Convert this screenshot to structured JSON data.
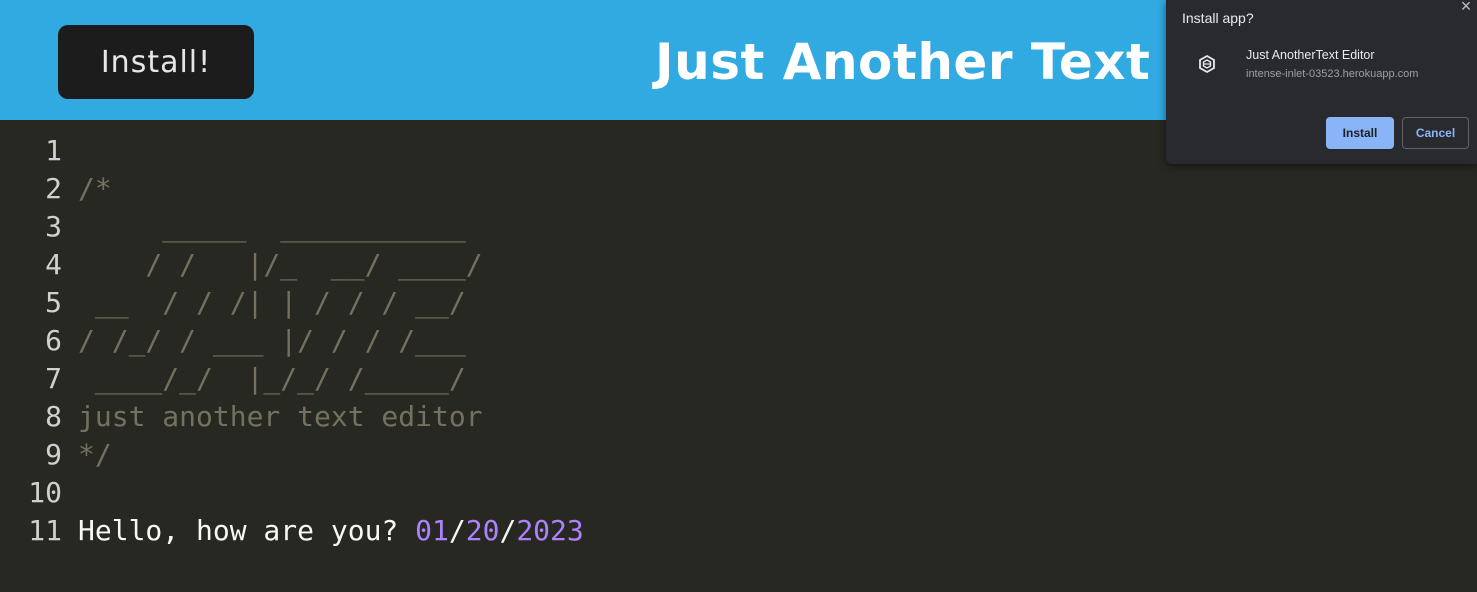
{
  "header": {
    "install_label": "Install!",
    "title": "Just Another Text"
  },
  "editor": {
    "lines": [
      {
        "number": "1",
        "segments": []
      },
      {
        "number": "2",
        "segments": [
          {
            "text": "/*",
            "kind": "comment"
          }
        ]
      },
      {
        "number": "3",
        "segments": [
          {
            "text": "     _____  ___________",
            "kind": "comment"
          }
        ]
      },
      {
        "number": "4",
        "segments": [
          {
            "text": "    / /   |/_  __/ ____/",
            "kind": "comment"
          }
        ]
      },
      {
        "number": "5",
        "segments": [
          {
            "text": " __  / / /| | / / / __/",
            "kind": "comment"
          }
        ]
      },
      {
        "number": "6",
        "segments": [
          {
            "text": "/ /_/ / ___ |/ / / /___",
            "kind": "comment"
          }
        ]
      },
      {
        "number": "7",
        "segments": [
          {
            "text": " ____/_/  |_/_/ /_____/",
            "kind": "comment"
          }
        ]
      },
      {
        "number": "8",
        "segments": [
          {
            "text": "just another text editor",
            "kind": "comment"
          }
        ]
      },
      {
        "number": "9",
        "segments": [
          {
            "text": "*/",
            "kind": "comment"
          }
        ]
      },
      {
        "number": "10",
        "segments": []
      },
      {
        "number": "11",
        "segments": [
          {
            "text": "Hello, how are you? ",
            "kind": "plain"
          },
          {
            "text": "01",
            "kind": "num"
          },
          {
            "text": "/",
            "kind": "plain"
          },
          {
            "text": "20",
            "kind": "num"
          },
          {
            "text": "/",
            "kind": "plain"
          },
          {
            "text": "2023",
            "kind": "num"
          }
        ]
      }
    ]
  },
  "install_dialog": {
    "title": "Install app?",
    "close_glyph": "×",
    "app_icon": "app-logo-icon",
    "app_name": "Just AnotherText Editor",
    "app_origin": "intense-inlet-03523.herokuapp.com",
    "install_label": "Install",
    "cancel_label": "Cancel"
  },
  "colors": {
    "header_bg": "#31a9e1",
    "editor_bg": "#272822",
    "comment": "#75715e",
    "number": "#ae81ff",
    "dialog_accent": "#8ab4f8"
  }
}
